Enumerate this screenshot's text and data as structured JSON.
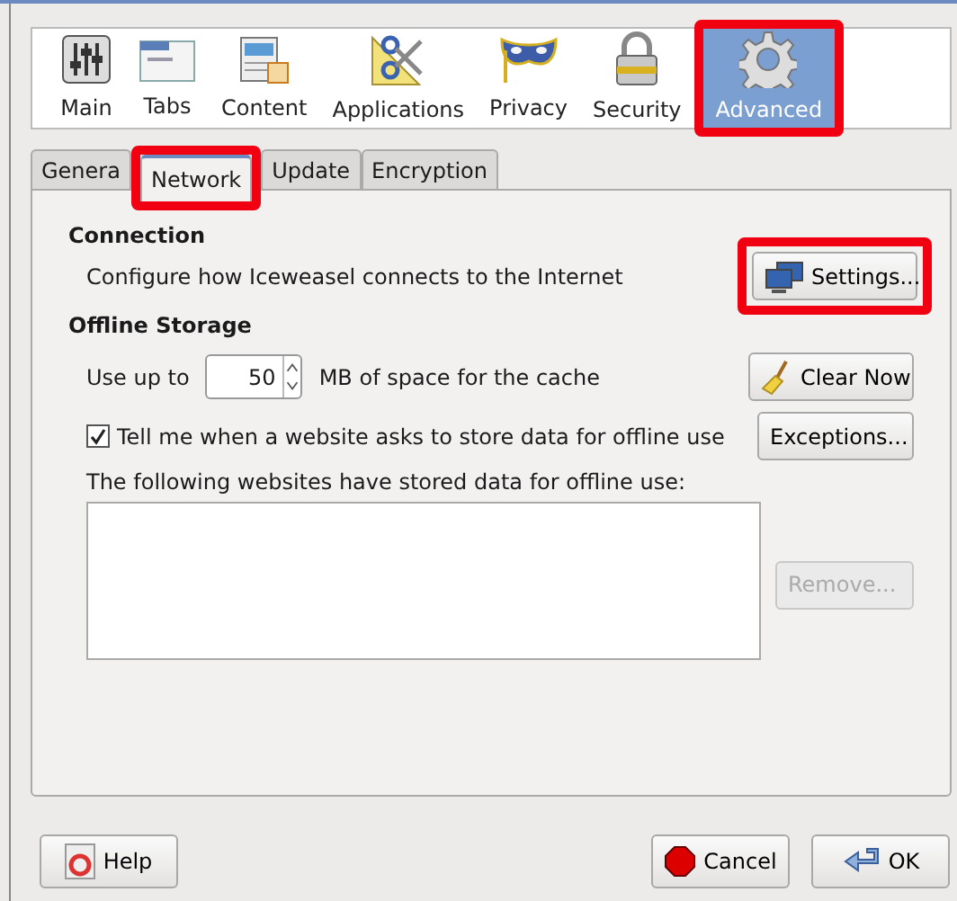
{
  "panes": [
    {
      "label": "Main",
      "kind": "sliders",
      "selected": false,
      "highlighted": false
    },
    {
      "label": "Tabs",
      "kind": "tabs",
      "selected": false,
      "highlighted": false
    },
    {
      "label": "Content",
      "kind": "content",
      "selected": false,
      "highlighted": false
    },
    {
      "label": "Applications",
      "kind": "tools",
      "selected": false,
      "highlighted": false
    },
    {
      "label": "Privacy",
      "kind": "mask",
      "selected": false,
      "highlighted": false
    },
    {
      "label": "Security",
      "kind": "lock",
      "selected": false,
      "highlighted": false
    },
    {
      "label": "Advanced",
      "kind": "gear",
      "selected": true,
      "highlighted": true
    }
  ],
  "tabs": [
    {
      "label": "Genera",
      "selected": false,
      "highlighted": false
    },
    {
      "label": "Network",
      "selected": true,
      "highlighted": true
    },
    {
      "label": "Update",
      "selected": false,
      "highlighted": false
    },
    {
      "label": "Encryption",
      "selected": false,
      "highlighted": false
    }
  ],
  "connection": {
    "heading": "Connection",
    "description": "Configure how Iceweasel connects to the Internet",
    "settings_button": {
      "label": "Settings...",
      "highlighted": true
    }
  },
  "offline_storage": {
    "heading": "Offline Storage",
    "use_up_to": "Use up to",
    "cache_size": "50",
    "cache_unit": "MB of space for the cache",
    "clear_button": "Clear Now",
    "tell_me": {
      "label": "Tell me when a website asks to store data for offline use",
      "checked": true
    },
    "exceptions_button": "Exceptions...",
    "list_label": "The following websites have stored data for offline use:",
    "remove_button": {
      "label": "Remove...",
      "disabled": true
    }
  },
  "footer": {
    "help": "Help",
    "cancel": "Cancel",
    "ok": "OK"
  }
}
